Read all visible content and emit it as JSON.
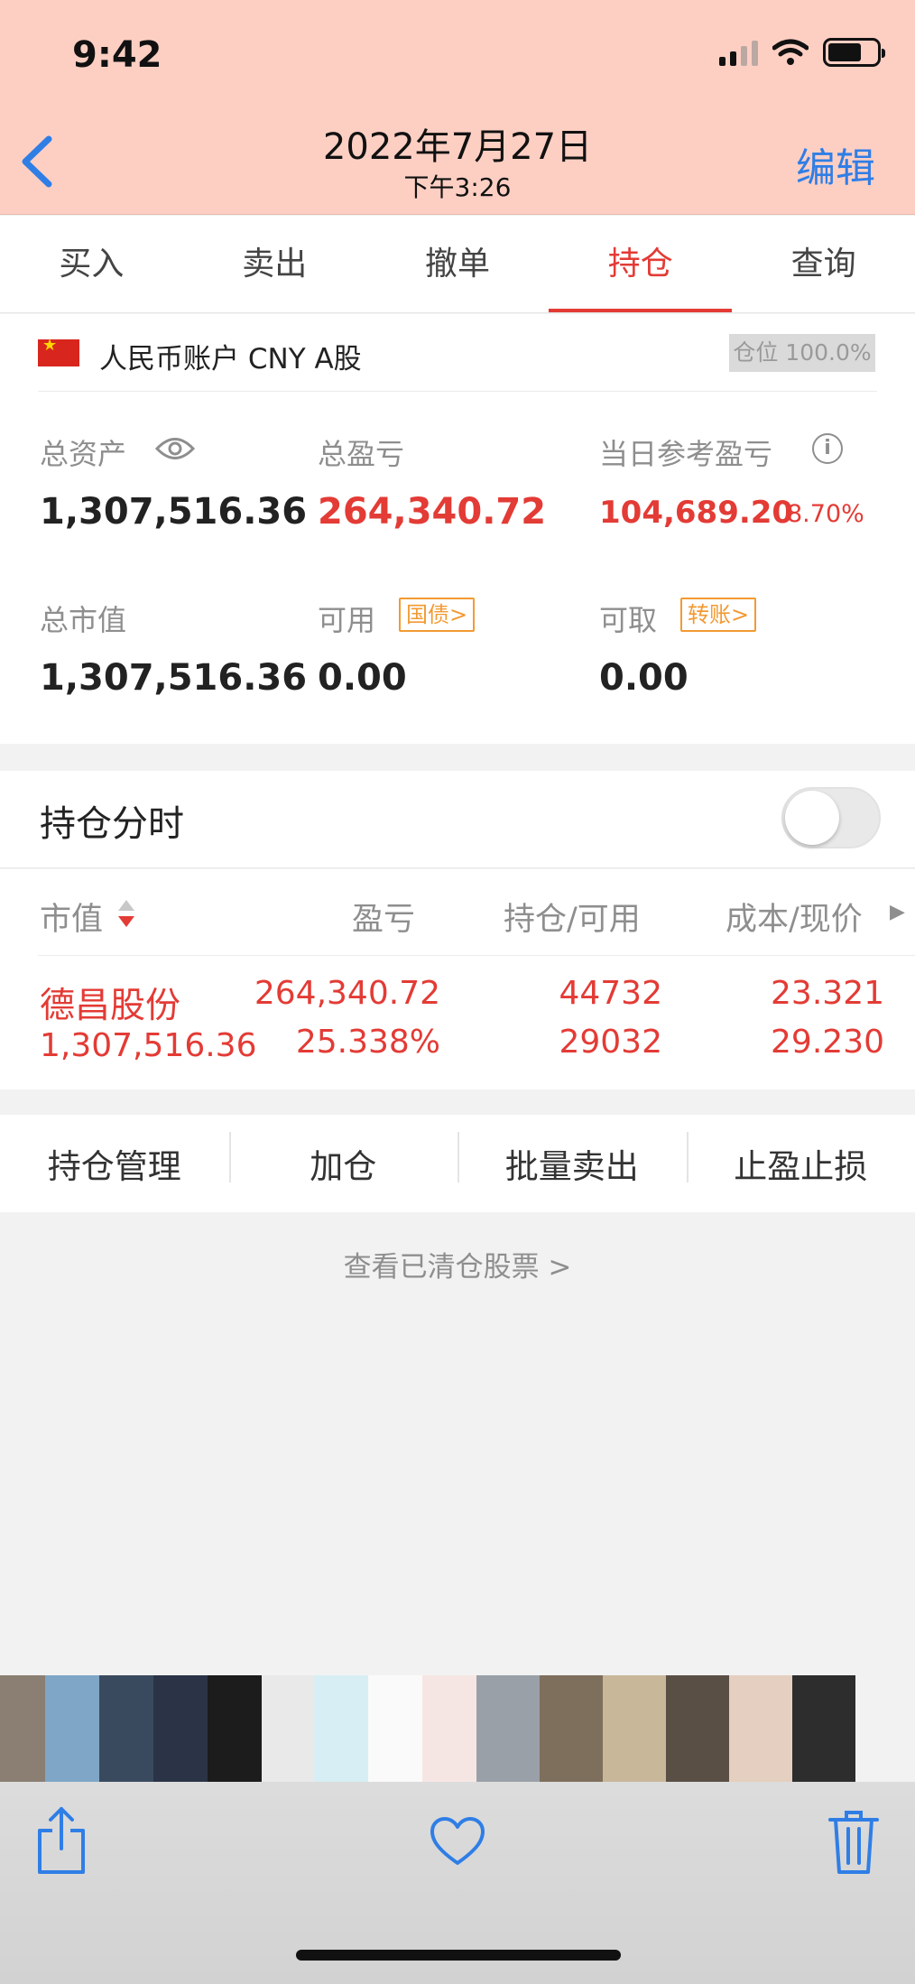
{
  "status_bar": {
    "time": "9:42"
  },
  "header": {
    "date": "2022年7月27日",
    "time": "下午3:26",
    "edit_label": "编辑"
  },
  "tabs": [
    {
      "label": "买入"
    },
    {
      "label": "卖出"
    },
    {
      "label": "撤单"
    },
    {
      "label": "持仓",
      "active": true
    },
    {
      "label": "查询"
    }
  ],
  "account": {
    "name": "人民币账户 CNY A股",
    "position_ratio": "仓位 100.0%",
    "total_assets_label": "总资产",
    "total_assets_value": "1,307,516.36",
    "total_pl_label": "总盈亏",
    "total_pl_value": "264,340.72",
    "daily_pl_label": "当日参考盈亏",
    "daily_pl_value": "104,689.20",
    "daily_pl_pct": "8.70%",
    "market_value_label": "总市值",
    "market_value_value": "1,307,516.36",
    "available_label": "可用",
    "available_tag": "国债>",
    "available_value": "0.00",
    "withdrawable_label": "可取",
    "withdrawable_tag": "转账>",
    "withdrawable_value": "0.00"
  },
  "timeshare": {
    "label": "持仓分时",
    "enabled": false
  },
  "holdings": {
    "columns": [
      "市值",
      "盈亏",
      "持仓/可用",
      "成本/现价"
    ],
    "rows": [
      {
        "name": "德昌股份",
        "market_value": "1,307,516.36",
        "pl": "264,340.72",
        "pl_pct": "25.338%",
        "position": "44732",
        "available": "29032",
        "cost": "23.321",
        "price": "29.230"
      }
    ]
  },
  "actions": [
    "持仓管理",
    "加仓",
    "批量卖出",
    "止盈止损"
  ],
  "cleared_link": "查看已清仓股票 >",
  "colors": {
    "header_bg": "#fdcfc3",
    "accent_red": "#e33b35",
    "link_blue": "#2f7ee6",
    "tag_orange": "#f29a32"
  },
  "thumbnail_colors": [
    "#8a7f72",
    "#7fa6c6",
    "#3a4a5e",
    "#2b3446",
    "#1c1c1c",
    "#e9e9e9",
    "#d7eef4",
    "#fafafa",
    "#f6e6e3",
    "#9aa0a8",
    "#7e6e5c",
    "#c9b79a",
    "#5a4f45",
    "#e4cfc0",
    "#2d2d2d"
  ],
  "toolbar_icons": [
    "share-icon",
    "heart-icon",
    "trash-icon"
  ]
}
